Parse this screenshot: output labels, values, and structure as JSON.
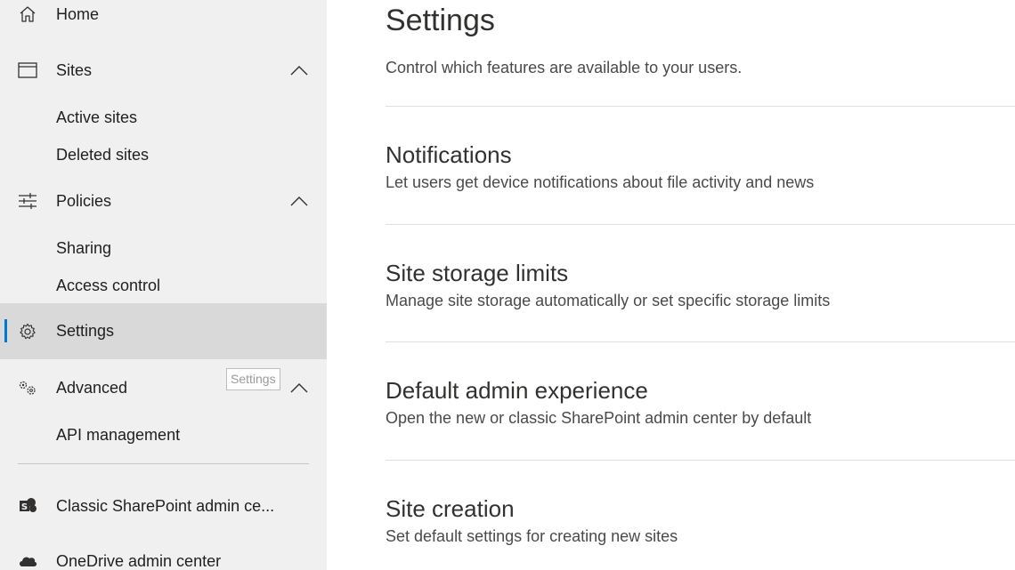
{
  "sidebar": {
    "items": [
      {
        "label": "Home",
        "icon": "home-icon"
      },
      {
        "label": "Sites",
        "icon": "browser-window-icon",
        "expanded": true
      },
      {
        "label": "Active sites"
      },
      {
        "label": "Deleted sites"
      },
      {
        "label": "Policies",
        "icon": "sliders-icon",
        "expanded": true
      },
      {
        "label": "Sharing"
      },
      {
        "label": "Access control"
      },
      {
        "label": "Settings",
        "icon": "gear-icon",
        "active": true
      },
      {
        "label": "Advanced",
        "icon": "gears-icon",
        "expanded": true
      },
      {
        "label": "API management"
      },
      {
        "label": "Classic SharePoint admin ce...",
        "icon": "sharepoint-icon"
      },
      {
        "label": "OneDrive admin center",
        "icon": "onedrive-cloud-icon"
      }
    ],
    "tooltip": "Settings",
    "accent_color": "#0078d4"
  },
  "main": {
    "title": "Settings",
    "subtitle": "Control which features are available to your users.",
    "sections": [
      {
        "title": "Notifications",
        "description": "Let users get device notifications about file activity and news"
      },
      {
        "title": "Site storage limits",
        "description": "Manage site storage automatically or set specific storage limits"
      },
      {
        "title": "Default admin experience",
        "description": "Open the new or classic SharePoint admin center by default"
      },
      {
        "title": "Site creation",
        "description": "Set default settings for creating new sites"
      }
    ]
  }
}
